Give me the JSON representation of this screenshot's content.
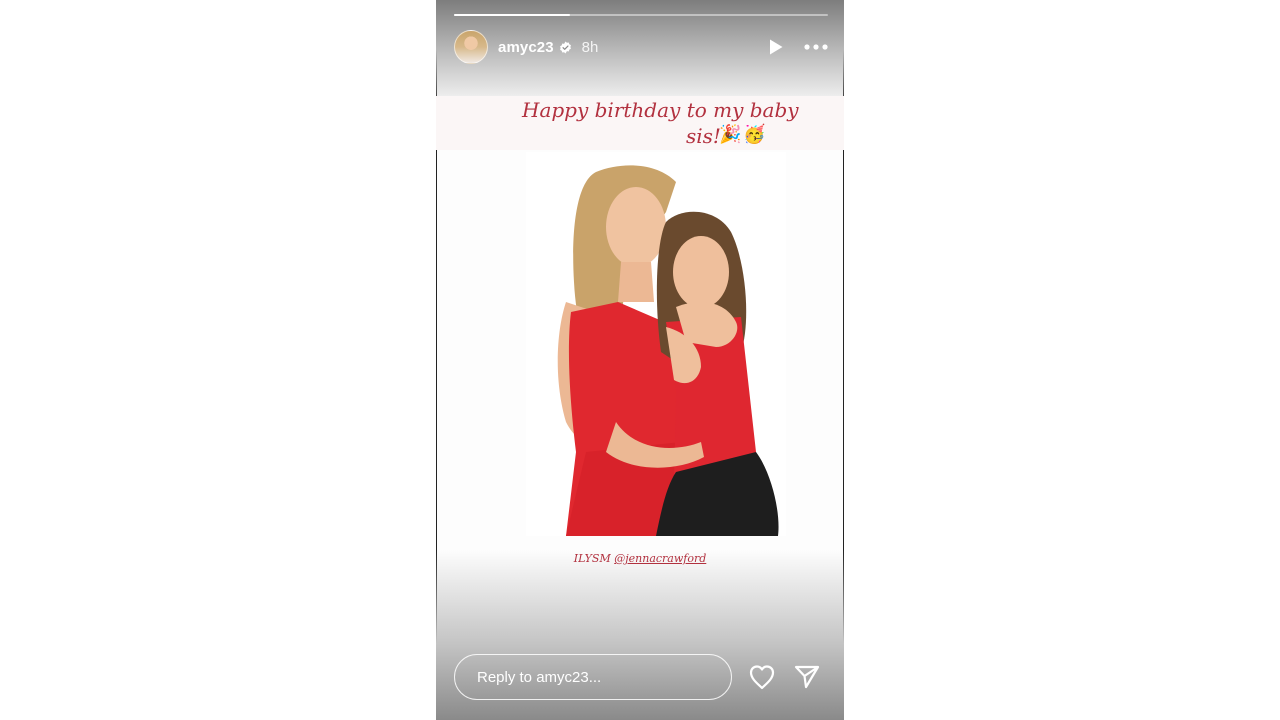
{
  "story": {
    "progress_fraction": 0.31,
    "user": {
      "username": "amyc23",
      "verified": true,
      "time_ago": "8h"
    },
    "icons": {
      "play": "play-icon",
      "more": "more-options-icon",
      "like": "heart-icon",
      "share": "send-icon",
      "verified": "verified-badge-icon"
    },
    "caption": {
      "line1": "Happy birthday to my baby",
      "line2": "sis!",
      "emojis": [
        "🎉",
        "🥳"
      ]
    },
    "mention": {
      "prefix": "ILYSM",
      "handle": "@jennacrawford"
    },
    "reply": {
      "placeholder": "Reply to amyc23..."
    }
  }
}
